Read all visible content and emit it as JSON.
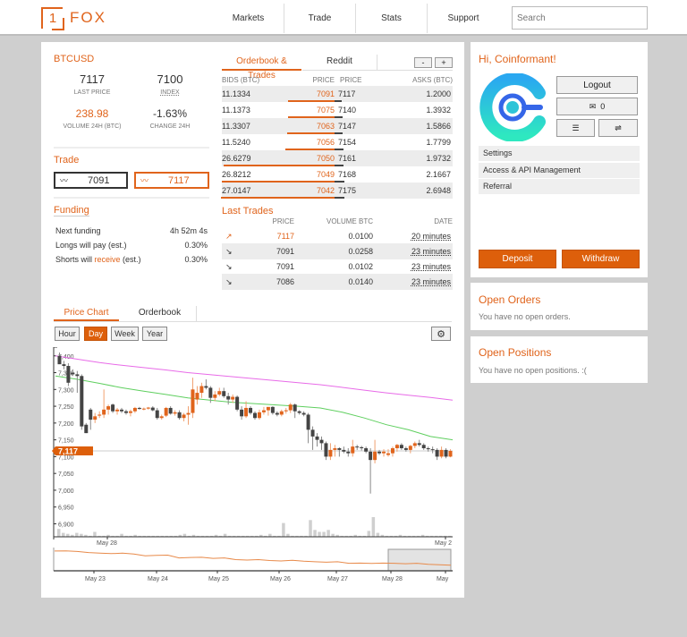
{
  "header": {
    "logo_mark": "1",
    "logo_text": "FOX",
    "nav": [
      "Markets",
      "Trade",
      "Stats",
      "Support"
    ],
    "search_placeholder": "Search"
  },
  "ticker": {
    "symbol": "BTCUSD",
    "last_price": "7117",
    "last_price_label": "LAST PRICE",
    "index": "7100",
    "index_label": "INDEX",
    "volume": "238.98",
    "volume_label": "VOLUME 24H (BTC)",
    "change": "-1.63%",
    "change_label": "CHANGE 24H"
  },
  "trade": {
    "title": "Trade",
    "sell_price": "7091",
    "buy_price": "7117"
  },
  "funding": {
    "title": "Funding",
    "rows": [
      {
        "label": "Next funding",
        "value": "4h 52m 4s"
      },
      {
        "label_pre": "Longs will pay (est.)",
        "value": "0.30%"
      },
      {
        "label_pre": "Shorts will ",
        "label_hl": "receive",
        "label_post": " (est.)",
        "value": "0.30%"
      }
    ]
  },
  "orderbook": {
    "tabs": [
      "Orderbook & Trades",
      "Reddit"
    ],
    "minus": "-",
    "plus": "+",
    "headers": [
      "BIDS (BTC)",
      "PRICE",
      "PRICE",
      "ASKS (BTC)"
    ],
    "rows": [
      {
        "bid": "11.1334",
        "bid_price": "7091",
        "ask_price": "7117",
        "ask": "1.2000",
        "depth": 0.41
      },
      {
        "bid": "11.1373",
        "bid_price": "7075",
        "ask_price": "7140",
        "ask": "1.3932",
        "depth": 0.41
      },
      {
        "bid": "11.3307",
        "bid_price": "7063",
        "ask_price": "7147",
        "ask": "1.5866",
        "depth": 0.42
      },
      {
        "bid": "11.5240",
        "bid_price": "7056",
        "ask_price": "7154",
        "ask": "1.7799",
        "depth": 0.43
      },
      {
        "bid": "26.6279",
        "bid_price": "7050",
        "ask_price": "7161",
        "ask": "1.9732",
        "depth": 0.98
      },
      {
        "bid": "26.8212",
        "bid_price": "7049",
        "ask_price": "7168",
        "ask": "2.1667",
        "depth": 0.99
      },
      {
        "bid": "27.0147",
        "bid_price": "7042",
        "ask_price": "7175",
        "ask": "2.6948",
        "depth": 1.0
      }
    ]
  },
  "last_trades": {
    "title": "Last Trades",
    "headers": [
      "PRICE",
      "VOLUME BTC",
      "DATE"
    ],
    "rows": [
      {
        "dir": "up",
        "price": "7117",
        "volume": "0.0100",
        "date": "20 minutes"
      },
      {
        "dir": "down",
        "price": "7091",
        "volume": "0.0258",
        "date": "23 minutes"
      },
      {
        "dir": "down",
        "price": "7091",
        "volume": "0.0102",
        "date": "23 minutes"
      },
      {
        "dir": "down",
        "price": "7086",
        "volume": "0.0140",
        "date": "23 minutes"
      }
    ]
  },
  "account": {
    "greeting": "Hi, Coinformant!",
    "logout": "Logout",
    "messages": "0",
    "menu": [
      "Settings",
      "Access & API Management",
      "Referral"
    ],
    "deposit": "Deposit",
    "withdraw": "Withdraw"
  },
  "open_orders": {
    "title": "Open Orders",
    "text": "You have no open orders."
  },
  "open_positions": {
    "title": "Open Positions",
    "text": "You have no open positions. :("
  },
  "chart_tabs": [
    "Price Chart",
    "Orderbook"
  ],
  "timeframes": [
    "Hour",
    "Day",
    "Week",
    "Year"
  ],
  "active_timeframe": "Day",
  "colors": {
    "accent": "#e0641c",
    "button": "#dd5f0b",
    "up": "#e0641c",
    "down": "#444444",
    "ma_fast": "#5fcf5f",
    "ma_slow": "#e86be8"
  },
  "chart_data": {
    "type": "candlestick",
    "y_ticks": [
      "7,400",
      "7,350",
      "7,300",
      "7,250",
      "7,200",
      "7,150",
      "7,100",
      "7,050",
      "7,000",
      "6,950",
      "6,900"
    ],
    "ylim": [
      6880,
      7410
    ],
    "current_price_label": "7,117",
    "current_price": 7117,
    "main_x_labels": [
      "May 28",
      "May 2"
    ],
    "navigator_x_labels": [
      "May 23",
      "May 24",
      "May 25",
      "May 26",
      "May 27",
      "May 28",
      "May"
    ],
    "candles": [
      [
        7400,
        7410,
        7380,
        7375
      ],
      [
        7375,
        7385,
        7360,
        7370
      ],
      [
        7370,
        7378,
        7310,
        7320
      ],
      [
        7350,
        7360,
        7340,
        7345
      ],
      [
        7345,
        7355,
        7290,
        7340
      ],
      [
        7340,
        7345,
        7180,
        7190
      ],
      [
        7195,
        7200,
        7170,
        7170
      ],
      [
        7240,
        7245,
        7180,
        7210
      ],
      [
        7210,
        7230,
        7200,
        7220
      ],
      [
        7222,
        7235,
        7215,
        7225
      ],
      [
        7225,
        7300,
        7215,
        7240
      ],
      [
        7240,
        7255,
        7225,
        7250
      ],
      [
        7255,
        7258,
        7230,
        7235
      ],
      [
        7235,
        7245,
        7225,
        7240
      ],
      [
        7240,
        7245,
        7230,
        7235
      ],
      [
        7235,
        7240,
        7225,
        7230
      ],
      [
        7230,
        7240,
        7220,
        7235
      ],
      [
        7235,
        7248,
        7230,
        7245
      ],
      [
        7245,
        7248,
        7240,
        7242
      ],
      [
        7242,
        7246,
        7238,
        7243
      ],
      [
        7243,
        7248,
        7240,
        7246
      ],
      [
        7246,
        7250,
        7235,
        7238
      ],
      [
        7238,
        7245,
        7210,
        7215
      ],
      [
        7215,
        7225,
        7210,
        7220
      ],
      [
        7222,
        7248,
        7218,
        7245
      ],
      [
        7245,
        7250,
        7225,
        7228
      ],
      [
        7228,
        7238,
        7222,
        7232
      ],
      [
        7232,
        7238,
        7210,
        7215
      ],
      [
        7215,
        7230,
        7205,
        7225
      ],
      [
        7225,
        7250,
        7195,
        7230
      ],
      [
        7230,
        7335,
        7215,
        7300
      ],
      [
        7270,
        7310,
        7255,
        7290
      ],
      [
        7290,
        7320,
        7275,
        7310
      ],
      [
        7310,
        7330,
        7300,
        7305
      ],
      [
        7305,
        7310,
        7260,
        7275
      ],
      [
        7275,
        7295,
        7265,
        7285
      ],
      [
        7285,
        7305,
        7280,
        7295
      ],
      [
        7295,
        7305,
        7275,
        7280
      ],
      [
        7280,
        7290,
        7255,
        7270
      ],
      [
        7270,
        7285,
        7260,
        7278
      ],
      [
        7278,
        7282,
        7235,
        7240
      ],
      [
        7240,
        7250,
        7210,
        7220
      ],
      [
        7220,
        7265,
        7215,
        7245
      ],
      [
        7245,
        7250,
        7225,
        7230
      ],
      [
        7230,
        7235,
        7210,
        7215
      ],
      [
        7215,
        7240,
        7210,
        7232
      ],
      [
        7232,
        7248,
        7225,
        7238
      ],
      [
        7238,
        7246,
        7222,
        7248
      ],
      [
        7248,
        7250,
        7225,
        7230
      ],
      [
        7230,
        7235,
        7220,
        7225
      ],
      [
        7225,
        7240,
        7220,
        7235
      ],
      [
        7235,
        7245,
        7228,
        7238
      ],
      [
        7238,
        7260,
        7230,
        7255
      ],
      [
        7255,
        7258,
        7215,
        7235
      ],
      [
        7235,
        7238,
        7225,
        7230
      ],
      [
        7230,
        7235,
        7220,
        7225
      ],
      [
        7225,
        7230,
        7140,
        7180
      ],
      [
        7180,
        7190,
        7120,
        7160
      ],
      [
        7160,
        7170,
        7130,
        7150
      ],
      [
        7150,
        7160,
        7120,
        7140
      ],
      [
        7140,
        7145,
        7090,
        7100
      ],
      [
        7100,
        7140,
        7090,
        7120
      ],
      [
        7120,
        7135,
        7100,
        7125
      ],
      [
        7125,
        7128,
        7100,
        7120
      ],
      [
        7120,
        7130,
        7110,
        7115
      ],
      [
        7115,
        7125,
        7100,
        7110
      ],
      [
        7110,
        7150,
        7100,
        7130
      ],
      [
        7130,
        7135,
        7120,
        7128
      ],
      [
        7128,
        7132,
        7118,
        7125
      ],
      [
        7125,
        7130,
        7110,
        7115
      ],
      [
        7115,
        7125,
        6990,
        7090
      ],
      [
        7090,
        7150,
        7080,
        7115
      ],
      [
        7115,
        7120,
        7105,
        7110
      ],
      [
        7110,
        7122,
        7100,
        7115
      ],
      [
        7105,
        7122,
        7100,
        7110
      ],
      [
        7110,
        7130,
        7100,
        7125
      ],
      [
        7125,
        7138,
        7115,
        7135
      ],
      [
        7135,
        7140,
        7120,
        7125
      ],
      [
        7125,
        7130,
        7115,
        7120
      ],
      [
        7120,
        7135,
        7110,
        7132
      ],
      [
        7132,
        7145,
        7125,
        7140
      ],
      [
        7140,
        7150,
        7130,
        7135
      ],
      [
        7135,
        7140,
        7120,
        7125
      ],
      [
        7125,
        7130,
        7115,
        7122
      ],
      [
        7122,
        7130,
        7110,
        7120
      ],
      [
        7120,
        7125,
        7090,
        7100
      ],
      [
        7100,
        7130,
        7095,
        7120
      ],
      [
        7120,
        7125,
        7095,
        7100
      ],
      [
        7100,
        7122,
        7098,
        7117
      ]
    ],
    "ma_fast": [
      7340,
      7330,
      7318,
      7305,
      7295,
      7285,
      7275,
      7268,
      7262,
      7258,
      7254,
      7250,
      7245,
      7232,
      7215,
      7195,
      7180,
      7160,
      7150
    ],
    "ma_slow": [
      7400,
      7390,
      7380,
      7372,
      7365,
      7358,
      7350,
      7344,
      7338,
      7332,
      7326,
      7320,
      7314,
      7306,
      7298,
      7290,
      7283,
      7276,
      7268
    ],
    "volumes": [
      8,
      4,
      3,
      2,
      4,
      3,
      2,
      1,
      5,
      1,
      1,
      2,
      1,
      1,
      3,
      1,
      1,
      2,
      1,
      1,
      1,
      1,
      1,
      1,
      1,
      1,
      1,
      2,
      3,
      1,
      2,
      1,
      1,
      1,
      1,
      2,
      1,
      3,
      1,
      1,
      1,
      1,
      1,
      1,
      1,
      2,
      1,
      3,
      1,
      1,
      14,
      3,
      1,
      1,
      1,
      1,
      17,
      7,
      5,
      5,
      7,
      3,
      2,
      1,
      1,
      1,
      2,
      1,
      1,
      6,
      20,
      4,
      2,
      1,
      1,
      1,
      2,
      1,
      1,
      1,
      1,
      2,
      1,
      1,
      1,
      1,
      1,
      1
    ],
    "navigator": [
      0.92,
      0.93,
      0.9,
      0.85,
      0.82,
      0.8,
      0.82,
      0.78,
      0.7,
      0.72,
      0.73,
      0.6,
      0.62,
      0.63,
      0.58,
      0.6,
      0.52,
      0.5,
      0.52,
      0.48,
      0.46,
      0.49,
      0.45,
      0.42,
      0.4,
      0.42,
      0.35,
      0.36,
      0.34,
      0.36,
      0.35,
      0.33,
      0.35,
      0.3,
      0.28,
      0.26
    ]
  }
}
